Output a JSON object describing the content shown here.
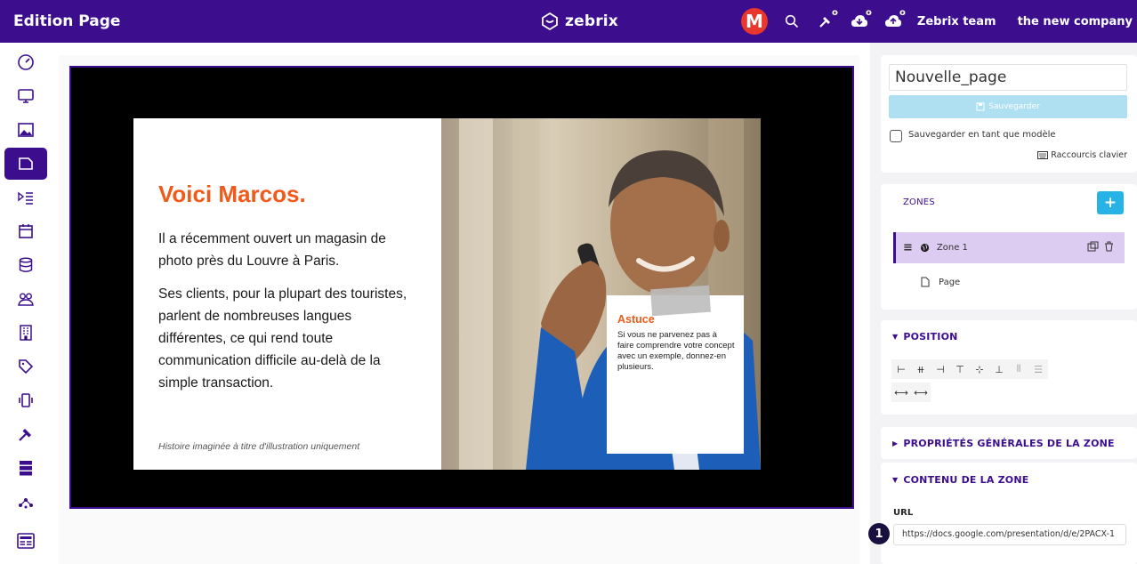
{
  "header": {
    "title": "Edition Page",
    "brand": "zebrix",
    "avatar_letter": "M",
    "team_label": "Zebrix team",
    "company_label": "the new company"
  },
  "sidebar": {
    "items": [
      {
        "icon": "dashboard-icon"
      },
      {
        "icon": "monitor-icon"
      },
      {
        "icon": "image-icon"
      },
      {
        "icon": "page-icon",
        "active": true
      },
      {
        "icon": "playlist-icon"
      },
      {
        "icon": "calendar-icon"
      },
      {
        "icon": "database-icon"
      },
      {
        "icon": "users-icon"
      },
      {
        "icon": "building-icon"
      },
      {
        "icon": "tag-icon"
      },
      {
        "icon": "device-icon"
      },
      {
        "icon": "tools-icon"
      },
      {
        "icon": "server-icon"
      },
      {
        "icon": "network-icon"
      },
      {
        "icon": "news-icon"
      }
    ]
  },
  "slide": {
    "title": "Voici Marcos.",
    "paragraph1": "Il a récemment ouvert un magasin de photo près du Louvre à Paris.",
    "paragraph2": "Ses clients, pour la plupart des touristes, parlent de nombreuses langues différentes, ce qui rend toute communication difficile au-delà de la simple transaction.",
    "caption": "Histoire imaginée à titre d'illustration uniquement",
    "tip_title": "Astuce",
    "tip_text": "Si vous ne parvenez pas à faire comprendre votre concept avec un exemple, donnez-en plusieurs."
  },
  "panel": {
    "page_name": "Nouvelle_page",
    "save_label": "Sauvegarder",
    "save_template_label": "Sauvegarder en tant que modèle",
    "shortcuts_label": "Raccourcis clavier",
    "zones_title": "ZONES",
    "add_label": "+",
    "zone_name": "Zone 1",
    "page_label": "Page",
    "position_title": "POSITION",
    "zone_props_title": "PROPRIÉTÉS GÉNÉRALES DE LA ZONE",
    "zone_content_title": "CONTENU DE LA ZONE",
    "url_label": "URL",
    "url_value": "https://docs.google.com/presentation/d/e/2PACX-1",
    "step_badge": "1"
  },
  "colors": {
    "brand": "#3c0e8e",
    "accent": "#f05a1a",
    "save": "#aee0f2",
    "add": "#27b3e6",
    "zone_selected": "#ddccf2"
  }
}
